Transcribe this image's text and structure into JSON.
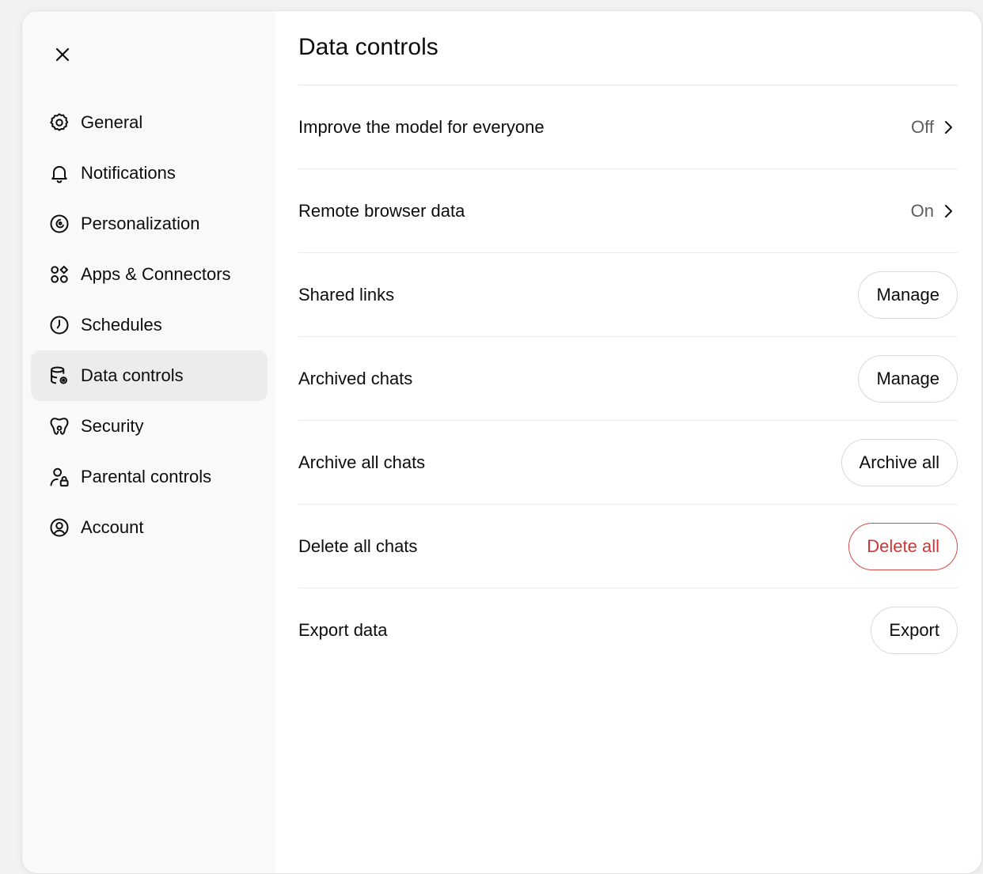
{
  "sidebar": {
    "close_icon": "close-icon",
    "items": [
      {
        "label": "General",
        "icon": "gear-icon",
        "active": false
      },
      {
        "label": "Notifications",
        "icon": "bell-icon",
        "active": false
      },
      {
        "label": "Personalization",
        "icon": "personalization-icon",
        "active": false
      },
      {
        "label": "Apps & Connectors",
        "icon": "apps-icon",
        "active": false
      },
      {
        "label": "Schedules",
        "icon": "clock-icon",
        "active": false
      },
      {
        "label": "Data controls",
        "icon": "database-icon",
        "active": true
      },
      {
        "label": "Security",
        "icon": "shield-icon",
        "active": false
      },
      {
        "label": "Parental controls",
        "icon": "parental-icon",
        "active": false
      },
      {
        "label": "Account",
        "icon": "user-circle-icon",
        "active": false
      }
    ]
  },
  "main": {
    "title": "Data controls",
    "rows": [
      {
        "label": "Improve the model for everyone",
        "value": "Off"
      },
      {
        "label": "Remote browser data",
        "value": "On"
      },
      {
        "label": "Shared links",
        "button": "Manage"
      },
      {
        "label": "Archived chats",
        "button": "Manage"
      },
      {
        "label": "Archive all chats",
        "button": "Archive all"
      },
      {
        "label": "Delete all chats",
        "button": "Delete all"
      },
      {
        "label": "Export data",
        "button": "Export"
      }
    ]
  },
  "colors": {
    "danger": "#d03434",
    "active_bg": "#ececec",
    "sidebar_bg": "#f9f9f9"
  }
}
